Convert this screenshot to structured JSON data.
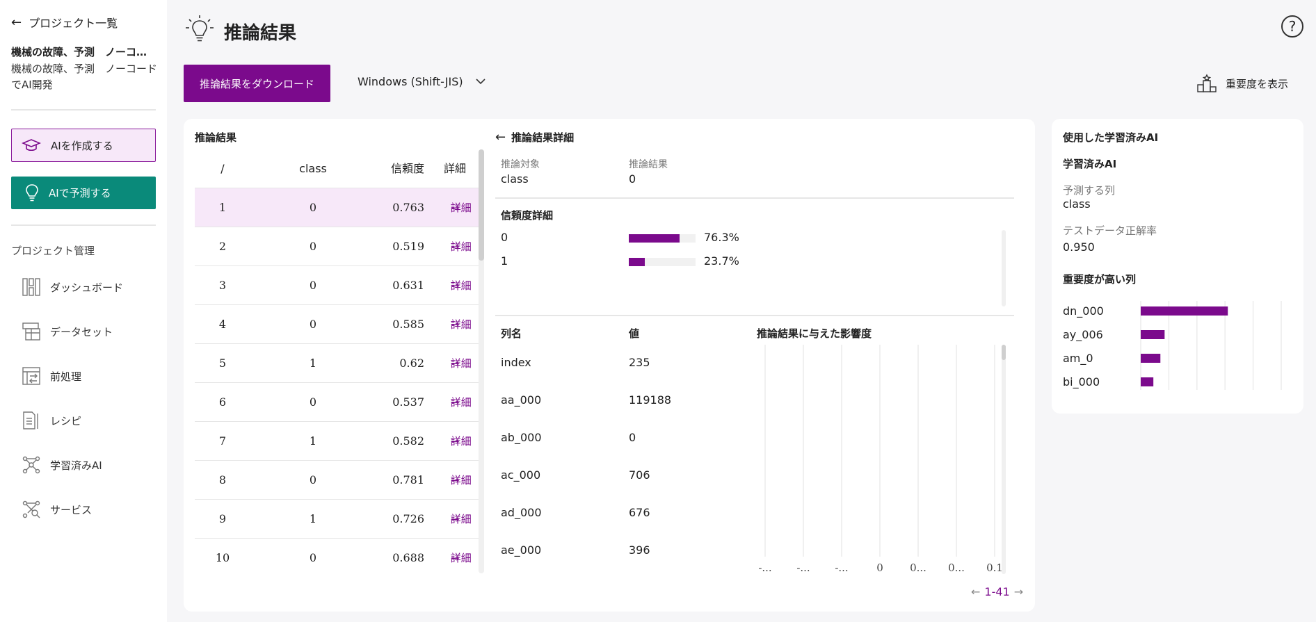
{
  "sidebar": {
    "back_label": "プロジェクト一覧",
    "project_title": "機械の故障、予測　ノーコードでAI開発",
    "project_desc": "機械の故障、予測　ノーコードでAI開発",
    "create_ai_label": "AIを作成する",
    "predict_ai_label": "AIで予測する",
    "section_label": "プロジェクト管理",
    "nav": [
      {
        "label": "ダッシュボード",
        "icon": "dashboard-icon"
      },
      {
        "label": "データセット",
        "icon": "dataset-icon"
      },
      {
        "label": "前処理",
        "icon": "preprocess-icon"
      },
      {
        "label": "レシピ",
        "icon": "recipe-icon"
      },
      {
        "label": "学習済みAI",
        "icon": "trained-ai-icon"
      },
      {
        "label": "サービス",
        "icon": "service-icon"
      }
    ]
  },
  "header": {
    "title": "推論結果",
    "download_label": "推論結果をダウンロード",
    "encoding": "Windows (Shift-JIS)",
    "importance_label": "重要度を表示"
  },
  "results": {
    "title": "推論結果",
    "columns": [
      "/",
      "class",
      "信頼度",
      "詳細"
    ],
    "detail_link": "詳細",
    "rows": [
      {
        "no": "1",
        "class": "0",
        "conf": "0.763"
      },
      {
        "no": "2",
        "class": "0",
        "conf": "0.519"
      },
      {
        "no": "3",
        "class": "0",
        "conf": "0.631"
      },
      {
        "no": "4",
        "class": "0",
        "conf": "0.585"
      },
      {
        "no": "5",
        "class": "1",
        "conf": "0.62"
      },
      {
        "no": "6",
        "class": "0",
        "conf": "0.537"
      },
      {
        "no": "7",
        "class": "1",
        "conf": "0.582"
      },
      {
        "no": "8",
        "class": "0",
        "conf": "0.781"
      },
      {
        "no": "9",
        "class": "1",
        "conf": "0.726"
      },
      {
        "no": "10",
        "class": "0",
        "conf": "0.688"
      }
    ],
    "pager": "1-41"
  },
  "detail": {
    "title": "推論結果詳細",
    "target_label": "推論対象",
    "target_value": "class",
    "result_label": "推論結果",
    "result_value": "0",
    "confidence_title": "信頼度詳細",
    "confidence": [
      {
        "label": "0",
        "value": 0.763,
        "pct": "76.3%"
      },
      {
        "label": "1",
        "value": 0.237,
        "pct": "23.7%"
      }
    ],
    "col_name_header": "列名",
    "value_header": "値",
    "influence_title": "推論結果に与えた影響度",
    "features": [
      {
        "name": "index",
        "value": "235"
      },
      {
        "name": "aa_000",
        "value": "119188"
      },
      {
        "name": "ab_000",
        "value": "0"
      },
      {
        "name": "ac_000",
        "value": "706"
      },
      {
        "name": "ad_000",
        "value": "676"
      },
      {
        "name": "ae_000",
        "value": "396"
      }
    ],
    "influence_ticks": [
      "-...",
      "-...",
      "-...",
      "0",
      "0...",
      "0...",
      "0.1"
    ]
  },
  "trained_ai": {
    "title": "使用した学習済みAI",
    "subtitle": "学習済みAI",
    "target_label": "予測する列",
    "target_value": "class",
    "accuracy_label": "テストデータ正解率",
    "accuracy_value": "0.950",
    "importance_title": "重要度が高い列"
  },
  "chart_data": {
    "type": "bar",
    "orientation": "horizontal",
    "categories": [
      "dn_000",
      "ay_006",
      "am_0",
      "bi_000"
    ],
    "values": [
      0.062,
      0.017,
      0.014,
      0.009
    ],
    "xlim": [
      0,
      0.1
    ],
    "xticks": [
      "0",
      "0.02",
      "0.04",
      "0.06",
      "0.08",
      "0.1"
    ],
    "color": "#7b0a8c",
    "grid": true
  },
  "colors": {
    "accent": "#7b0a8c",
    "teal": "#0a8a7a",
    "selected_bg": "#f7e8f9"
  }
}
